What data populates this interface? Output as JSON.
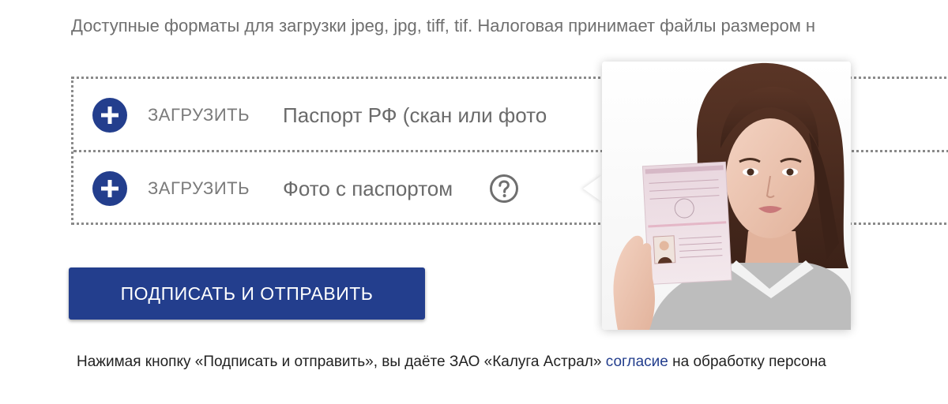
{
  "hint": {
    "text": "Доступные форматы для загрузки jpeg, jpg, tiff, tif. Налоговая принимает файлы размером н"
  },
  "uploads": [
    {
      "button_label": "ЗАГРУЗИТЬ",
      "document": "Паспорт РФ (скан или фото"
    },
    {
      "button_label": "ЗАГРУЗИТЬ",
      "document": "Фото с паспортом"
    }
  ],
  "submit": {
    "label": "ПОДПИСАТЬ И ОТПРАВИТЬ"
  },
  "consent": {
    "before": "Нажимая кнопку «Подписать и отправить», вы даёте ЗАО «Калуга Астрал» ",
    "link": "согласие",
    "after": " на обработку персона"
  },
  "colors": {
    "brand": "#233e8d",
    "text_muted": "#6f6f6f",
    "border": "#8a8a8a"
  },
  "icons": {
    "upload": "plus-circle-icon",
    "help": "question-circle-icon"
  }
}
